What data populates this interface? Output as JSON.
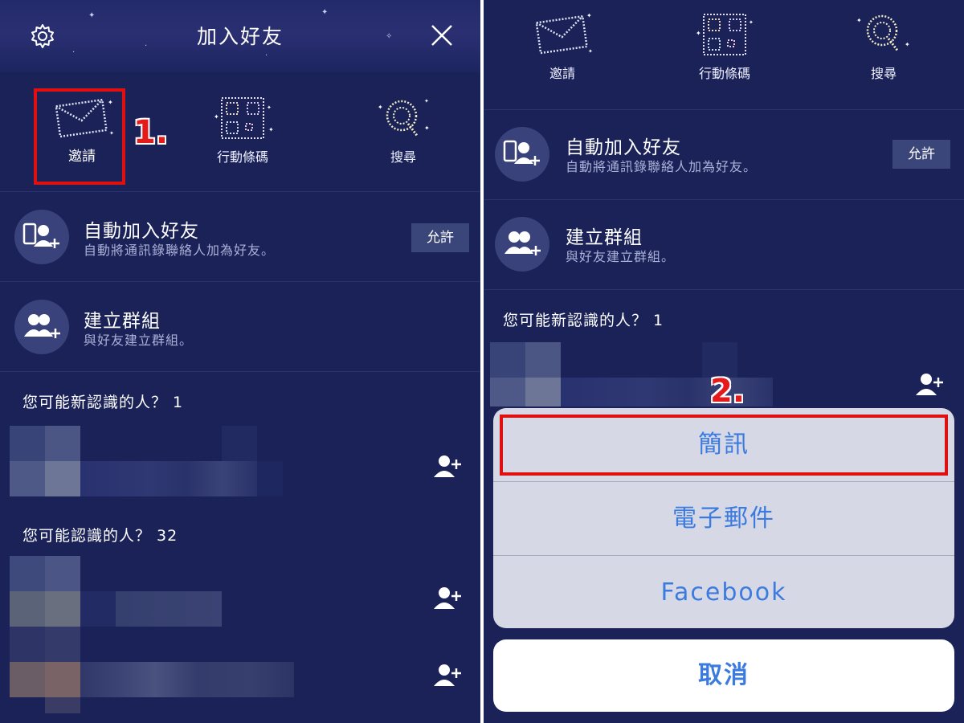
{
  "left_panel": {
    "header_title": "加入好友",
    "icons": [
      {
        "label": "邀請",
        "icon": "envelope-icon"
      },
      {
        "label": "行動條碼",
        "icon": "qr-code-icon"
      },
      {
        "label": "搜尋",
        "icon": "search-icon"
      }
    ],
    "auto_add": {
      "title": "自動加入好友",
      "subtitle": "自動將通訊錄聯絡人加為好友。",
      "button": "允許"
    },
    "create_group": {
      "title": "建立群組",
      "subtitle": "與好友建立群組。"
    },
    "section_new_people": "您可能新認識的人？ 1",
    "section_known_people": "您可能認識的人？ 32",
    "step_label": "1."
  },
  "right_panel": {
    "icons": [
      {
        "label": "邀請"
      },
      {
        "label": "行動條碼"
      },
      {
        "label": "搜尋"
      }
    ],
    "auto_add": {
      "title": "自動加入好友",
      "subtitle": "自動將通訊錄聯絡人加為好友。",
      "button": "允許"
    },
    "create_group": {
      "title": "建立群組",
      "subtitle": "與好友建立群組。"
    },
    "section_new_people": "您可能新認識的人？ 1",
    "step_label": "2.",
    "action_sheet": {
      "options": [
        "簡訊",
        "電子郵件",
        "Facebook"
      ],
      "cancel": "取消"
    }
  },
  "colors": {
    "background": "#1a2258",
    "highlight": "#e01010",
    "action_text": "#3b7be0"
  }
}
